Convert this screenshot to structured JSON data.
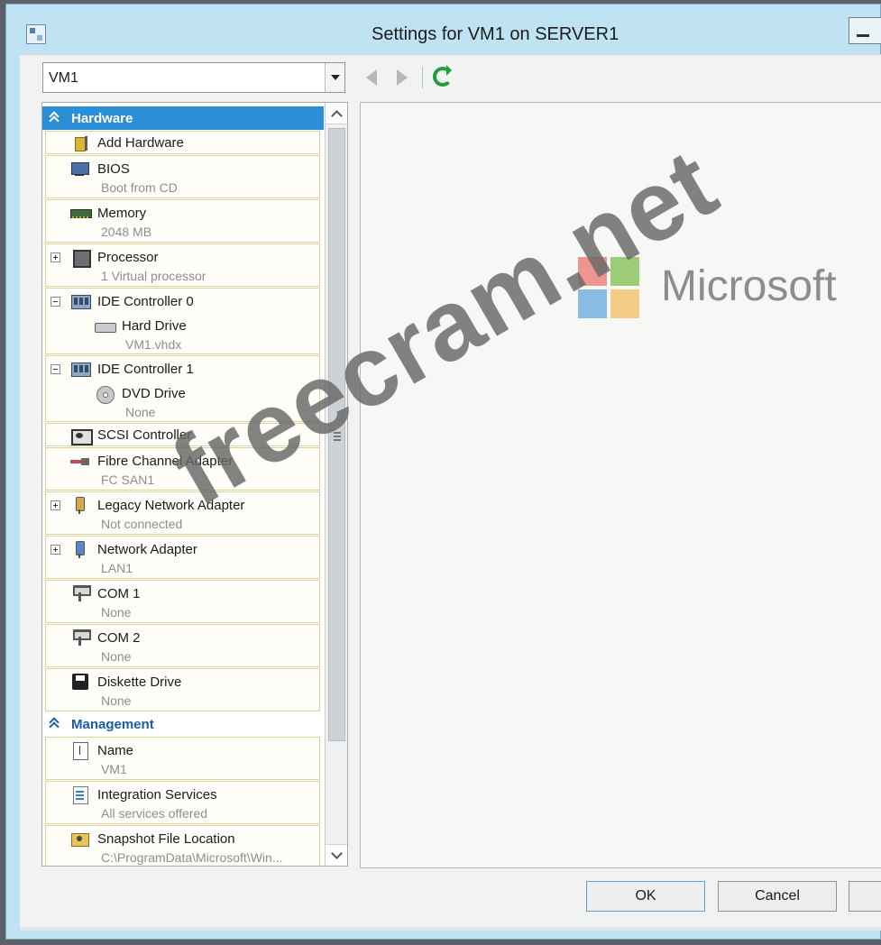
{
  "window": {
    "title": "Settings for VM1 on SERVER1"
  },
  "toolbar": {
    "vm_selected": "VM1"
  },
  "tree": {
    "hardware_header": "Hardware",
    "management_header": "Management",
    "hardware_items": [
      {
        "label": "Add Hardware",
        "sub": ""
      },
      {
        "label": "BIOS",
        "sub": "Boot from CD"
      },
      {
        "label": "Memory",
        "sub": "2048 MB"
      },
      {
        "label": "Processor",
        "sub": "1 Virtual processor"
      },
      {
        "label": "IDE Controller 0",
        "child_label": "Hard Drive",
        "child_sub": "VM1.vhdx"
      },
      {
        "label": "IDE Controller 1",
        "child_label": "DVD Drive",
        "child_sub": "None"
      },
      {
        "label": "SCSI Controller",
        "sub": ""
      },
      {
        "label": "Fibre Channel Adapter",
        "sub": "FC SAN1"
      },
      {
        "label": "Legacy Network Adapter",
        "sub": "Not connected"
      },
      {
        "label": "Network Adapter",
        "sub": "LAN1"
      },
      {
        "label": "COM 1",
        "sub": "None"
      },
      {
        "label": "COM 2",
        "sub": "None"
      },
      {
        "label": "Diskette Drive",
        "sub": "None"
      }
    ],
    "management_items": [
      {
        "label": "Name",
        "sub": "VM1"
      },
      {
        "label": "Integration Services",
        "sub": "All services offered"
      },
      {
        "label": "Snapshot File Location",
        "sub": "C:\\ProgramData\\Microsoft\\Win..."
      }
    ]
  },
  "watermark": {
    "logo_text": "Microsoft",
    "text": "freecram.net"
  },
  "buttons": {
    "ok": "OK",
    "cancel": "Cancel"
  },
  "colors": {
    "title_bar": "#bfe3f3",
    "selected_header": "#2c8fd6",
    "item_border": "#ded29a"
  }
}
